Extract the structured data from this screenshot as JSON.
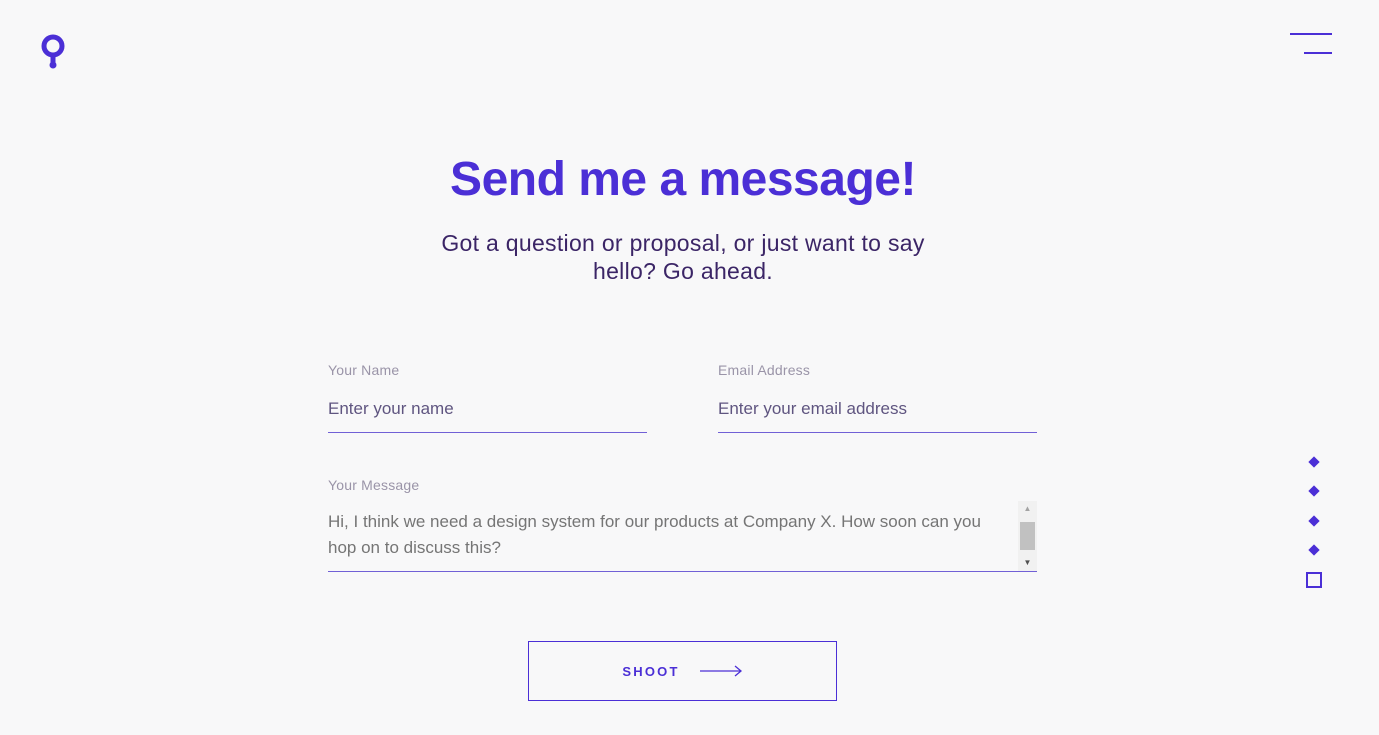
{
  "brand": {
    "logo_icon": "location-pin-icon",
    "accent_color": "#4b2fd6"
  },
  "header": {
    "menu_icon": "hamburger-menu-icon"
  },
  "main": {
    "title": "Send me a message!",
    "subtitle": "Got a question or proposal, or just want to say hello? Go ahead."
  },
  "form": {
    "name": {
      "label": "Your Name",
      "placeholder": "Enter your name",
      "value": ""
    },
    "email": {
      "label": "Email Address",
      "placeholder": "Enter your email address",
      "value": ""
    },
    "message": {
      "label": "Your Message",
      "placeholder": "Hi, I think we need a design system for our products at Company X. How soon can you hop on to discuss this?",
      "value": ""
    },
    "submit_label": "SHOOT"
  },
  "page_nav": {
    "items": [
      "section-1",
      "section-2",
      "section-3",
      "section-4",
      "section-5"
    ],
    "active_index": 4
  }
}
